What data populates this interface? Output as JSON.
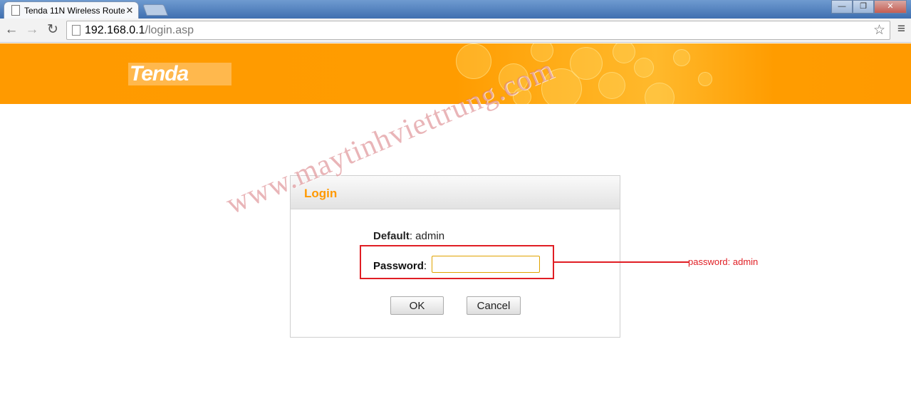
{
  "browser": {
    "tab_title": "Tenda 11N Wireless Route",
    "close_glyph": "✕",
    "window_buttons": [
      "—",
      "❐",
      "✕"
    ],
    "url_host": "192.168.0.1",
    "url_path": "/login.asp"
  },
  "banner": {
    "logo_text": "Tenda"
  },
  "login": {
    "title": "Login",
    "default_label": "Default",
    "default_value": ": admin",
    "password_label": "Password",
    "password_colon": ":",
    "password_value": "",
    "ok_label": "OK",
    "cancel_label": "Cancel"
  },
  "annotation": {
    "note": "password: admin",
    "color": "#e01e24"
  },
  "watermark": "www.maytinhviettrung.com",
  "colors": {
    "brand_orange": "#ff9900"
  }
}
